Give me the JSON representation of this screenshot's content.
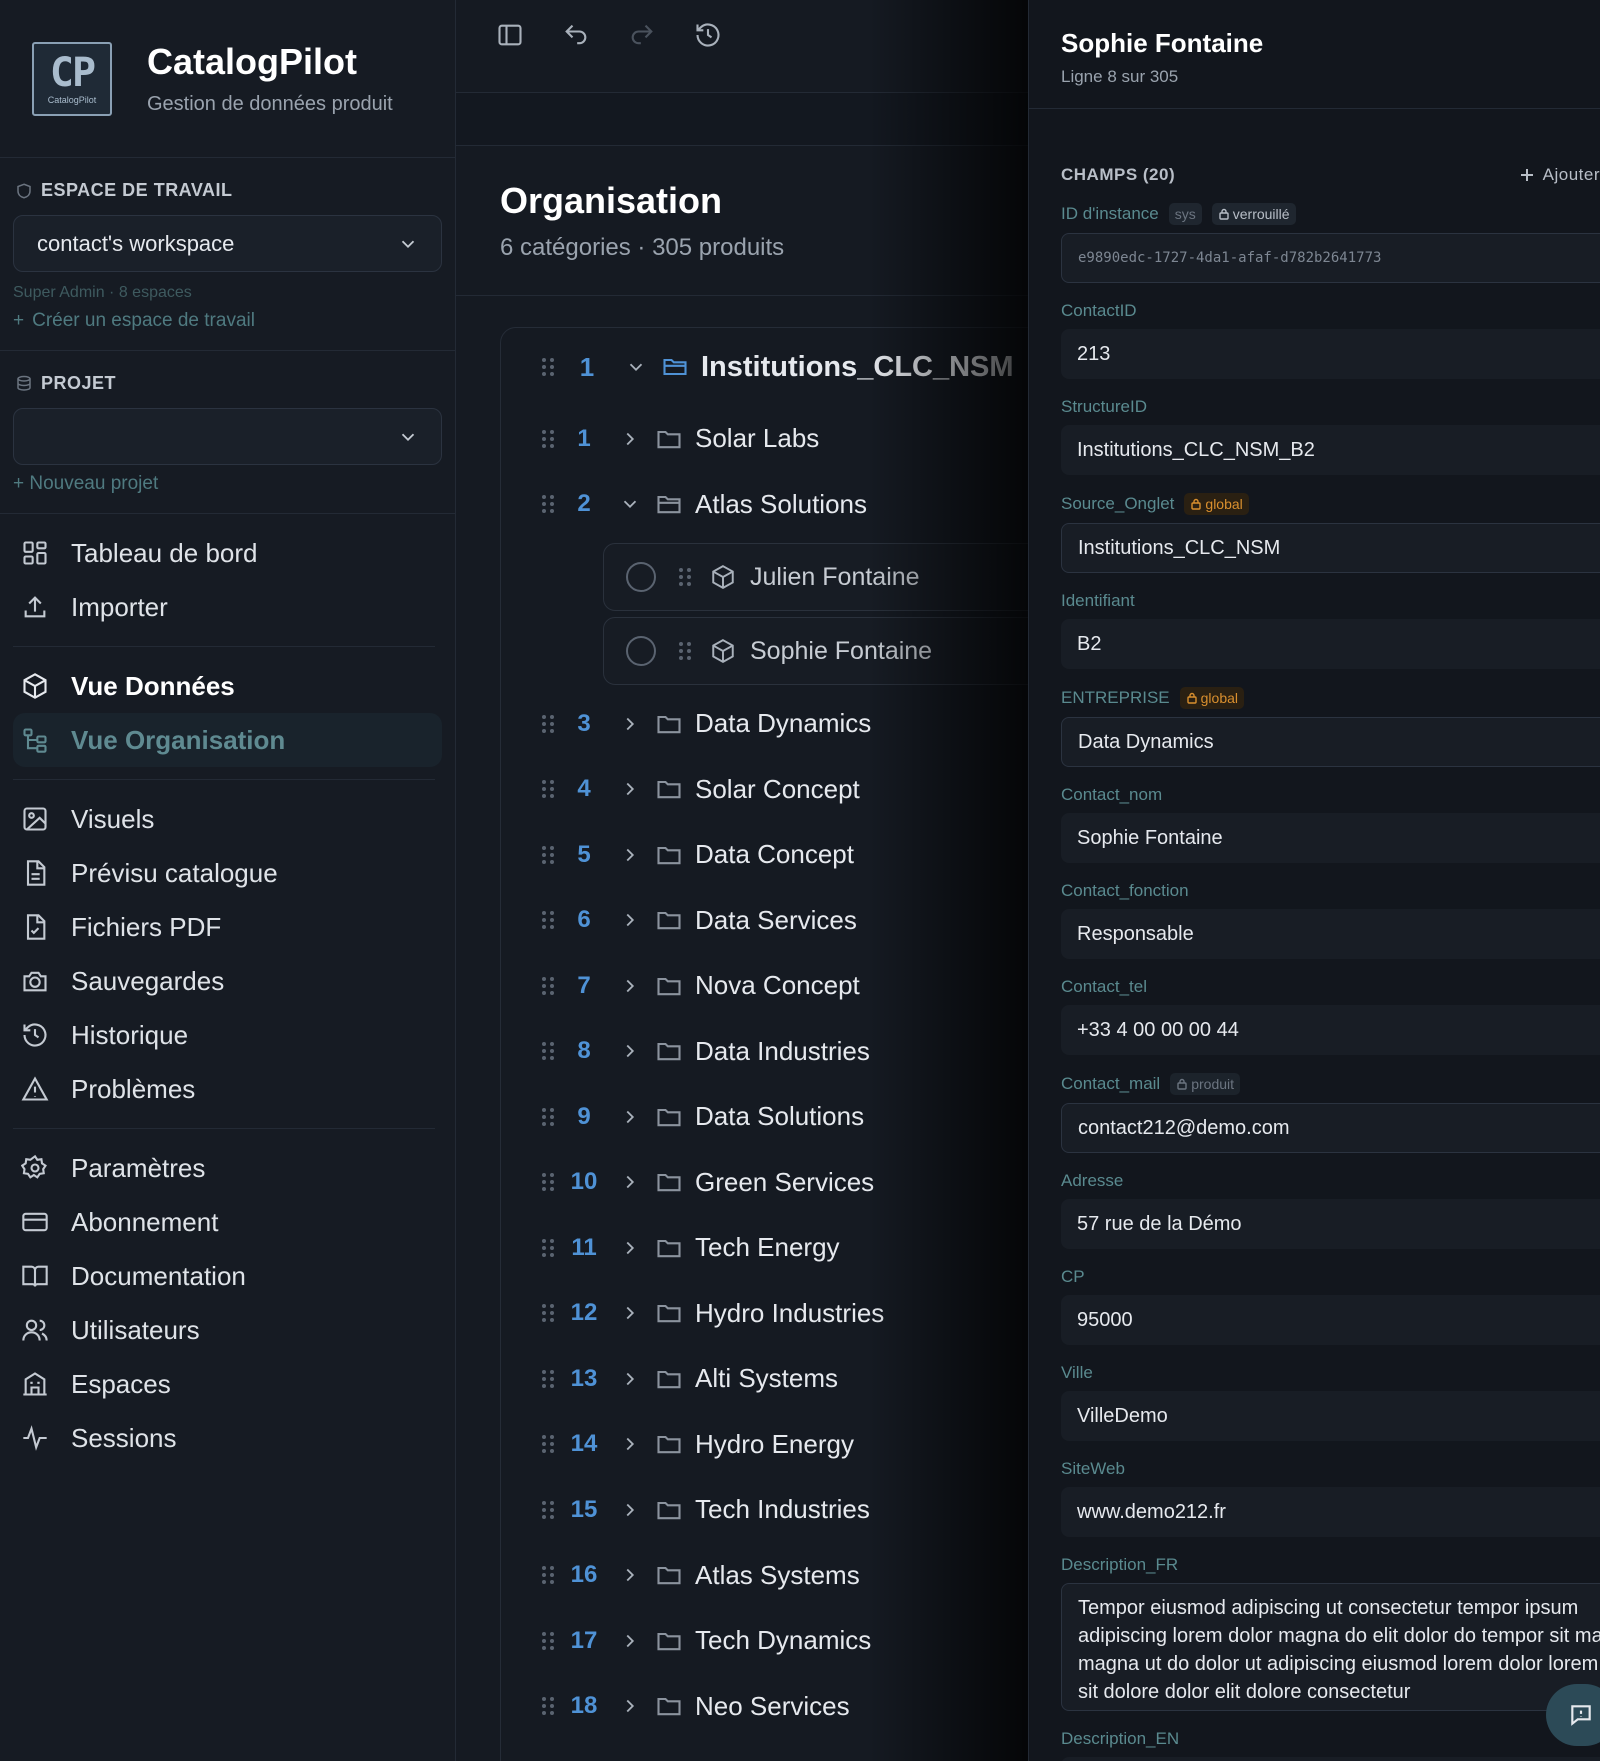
{
  "brand": {
    "logo_text": "CP",
    "logo_small": "CatalogPilot",
    "title": "CatalogPilot",
    "subtitle": "Gestion de données produit"
  },
  "workspace": {
    "heading": "ESPACE DE TRAVAIL",
    "selected": "contact's workspace",
    "hint": "Super Admin · 8 espaces",
    "create_label": "Créer un espace de travail"
  },
  "project": {
    "heading": "PROJET",
    "selected": "",
    "new_label": "+ Nouveau projet"
  },
  "nav": {
    "group1": [
      {
        "label": "Tableau de bord",
        "icon": "dashboard-icon"
      },
      {
        "label": "Importer",
        "icon": "upload-icon"
      }
    ],
    "group2": [
      {
        "label": "Vue Données",
        "icon": "cube-icon"
      },
      {
        "label": "Vue Organisation",
        "icon": "tree-icon",
        "active": true
      }
    ],
    "group3": [
      {
        "label": "Visuels",
        "icon": "image-icon"
      },
      {
        "label": "Prévisu catalogue",
        "icon": "document-icon"
      },
      {
        "label": "Fichiers PDF",
        "icon": "pdf-icon"
      },
      {
        "label": "Sauvegardes",
        "icon": "camera-icon"
      },
      {
        "label": "Historique",
        "icon": "history-icon"
      },
      {
        "label": "Problèmes",
        "icon": "warning-icon"
      }
    ],
    "group4": [
      {
        "label": "Paramètres",
        "icon": "gear-icon"
      },
      {
        "label": "Abonnement",
        "icon": "card-icon"
      },
      {
        "label": "Documentation",
        "icon": "book-icon"
      },
      {
        "label": "Utilisateurs",
        "icon": "users-icon"
      },
      {
        "label": "Espaces",
        "icon": "building-icon"
      },
      {
        "label": "Sessions",
        "icon": "activity-icon"
      }
    ]
  },
  "organisation": {
    "title": "Organisation",
    "subtitle": "6 catégories · 305 produits",
    "root": {
      "num": "1",
      "label": "Institutions_CLC_NSM"
    },
    "rows": [
      {
        "num": "1",
        "label": "Solar Labs",
        "expanded": false
      },
      {
        "num": "2",
        "label": "Atlas Solutions",
        "expanded": true,
        "children": [
          "Julien Fontaine",
          "Sophie Fontaine"
        ]
      },
      {
        "num": "3",
        "label": "Data Dynamics"
      },
      {
        "num": "4",
        "label": "Solar Concept"
      },
      {
        "num": "5",
        "label": "Data Concept"
      },
      {
        "num": "6",
        "label": "Data Services"
      },
      {
        "num": "7",
        "label": "Nova Concept"
      },
      {
        "num": "8",
        "label": "Data Industries"
      },
      {
        "num": "9",
        "label": "Data Solutions"
      },
      {
        "num": "10",
        "label": "Green Services"
      },
      {
        "num": "11",
        "label": "Tech Energy"
      },
      {
        "num": "12",
        "label": "Hydro Industries"
      },
      {
        "num": "13",
        "label": "Alti Systems"
      },
      {
        "num": "14",
        "label": "Hydro Energy"
      },
      {
        "num": "15",
        "label": "Tech Industries"
      },
      {
        "num": "16",
        "label": "Atlas Systems"
      },
      {
        "num": "17",
        "label": "Tech Dynamics"
      },
      {
        "num": "18",
        "label": "Neo Services"
      }
    ]
  },
  "panel": {
    "title": "Sophie Fontaine",
    "subtitle": "Ligne 8 sur 305",
    "fields_heading": "CHAMPS (20)",
    "add_label": "Ajouter",
    "fields": [
      {
        "label": "ID d'instance",
        "tags": [
          {
            "kind": "sys",
            "text": "sys"
          },
          {
            "kind": "lock",
            "text": "verrouillé"
          }
        ],
        "value": "e9890edc-1727-4da1-afaf-d782b2641773",
        "style": "mono"
      },
      {
        "label": "ContactID",
        "value": "213"
      },
      {
        "label": "StructureID",
        "value": "Institutions_CLC_NSM_B2"
      },
      {
        "label": "Source_Onglet",
        "tags": [
          {
            "kind": "global",
            "text": "global"
          }
        ],
        "value": "Institutions_CLC_NSM",
        "style": "bordered"
      },
      {
        "label": "Identifiant",
        "value": "B2"
      },
      {
        "label": "ENTREPRISE",
        "tags": [
          {
            "kind": "global",
            "text": "global"
          }
        ],
        "value": "Data Dynamics",
        "style": "bordered"
      },
      {
        "label": "Contact_nom",
        "value": "Sophie Fontaine"
      },
      {
        "label": "Contact_fonction",
        "value": "Responsable"
      },
      {
        "label": "Contact_tel",
        "value": "+33 4 00 00 00 44"
      },
      {
        "label": "Contact_mail",
        "tags": [
          {
            "kind": "produit",
            "text": "produit"
          }
        ],
        "value": "contact212@demo.com",
        "style": "bordered"
      },
      {
        "label": "Adresse",
        "value": "57 rue de la Démo"
      },
      {
        "label": "CP",
        "value": "95000"
      },
      {
        "label": "Ville",
        "value": "VilleDemo"
      },
      {
        "label": "SiteWeb",
        "value": "www.demo212.fr"
      },
      {
        "label": "Description_FR",
        "value": "Tempor eiusmod adipiscing ut consectetur tempor ipsum adipiscing lorem dolor magna do elit dolor do tempor sit magna magna ut do dolor ut adipiscing eiusmod lorem dolor lorem dolor sit dolore dolor elit dolore consectetur",
        "style": "area"
      },
      {
        "label": "Description_EN",
        "value": ""
      }
    ]
  },
  "colors": {
    "accent": "#4f92d6",
    "teal": "#5f8a91",
    "global_tag": "#d98f2e",
    "background": "#0f131a"
  }
}
